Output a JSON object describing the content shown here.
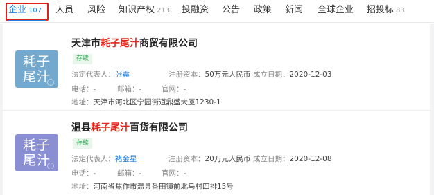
{
  "tabs": [
    {
      "label": "企业",
      "count": "107",
      "active": true
    },
    {
      "label": "人员",
      "count": ""
    },
    {
      "label": "风险",
      "count": ""
    },
    {
      "label": "知识产权",
      "count": "213"
    },
    {
      "label": "投融资",
      "count": ""
    },
    {
      "label": "公告",
      "count": ""
    },
    {
      "label": "政策",
      "count": ""
    },
    {
      "label": "新闻",
      "count": ""
    },
    {
      "label": "全球企业",
      "count": ""
    },
    {
      "label": "招投标",
      "count": "83"
    }
  ],
  "results": [
    {
      "name_prefix": "天津市",
      "name_keyword": "耗子尾汁",
      "name_suffix": "商贸有限公司",
      "logo_line1": "耗子",
      "logo_line2": "尾汁",
      "status": "存续",
      "legal_rep_label": "法定代表人：",
      "legal_rep": "张震",
      "capital_label": "注册资本：",
      "capital": "50万元人民币",
      "founded_label": "成立日期：",
      "founded": "2020-12-03",
      "phone_label": "电话：",
      "phone": "-",
      "email_label": "邮箱：",
      "email": "-",
      "website_label": "官网：",
      "website": "-",
      "address_label": "地址：",
      "address": "天津市河北区宁园街道鼎盛大厦1230-1"
    },
    {
      "name_prefix": "温县",
      "name_keyword": "耗子尾汁",
      "name_suffix": "百货有限公司",
      "logo_line1": "耗子",
      "logo_line2": "尾汁",
      "status": "存续",
      "legal_rep_label": "法定代表人：",
      "legal_rep": "褚金星",
      "capital_label": "注册资本：",
      "capital": "20万元人民币",
      "founded_label": "成立日期：",
      "founded": "2020-12-08",
      "phone_label": "电话：",
      "phone": "-",
      "email_label": "邮箱：",
      "email": "-",
      "website_label": "官网：",
      "website": "-",
      "address_label": "地址：",
      "address": "河南省焦作市温县番田镇前北马村四排15号"
    }
  ],
  "colors": {
    "accent": "#1a7ee6",
    "keyword": "#e5281d",
    "status": "#2fab55",
    "logo1": "#74a9cf",
    "logo2": "#8a8fd4",
    "highlight_box": "#e0201b"
  }
}
